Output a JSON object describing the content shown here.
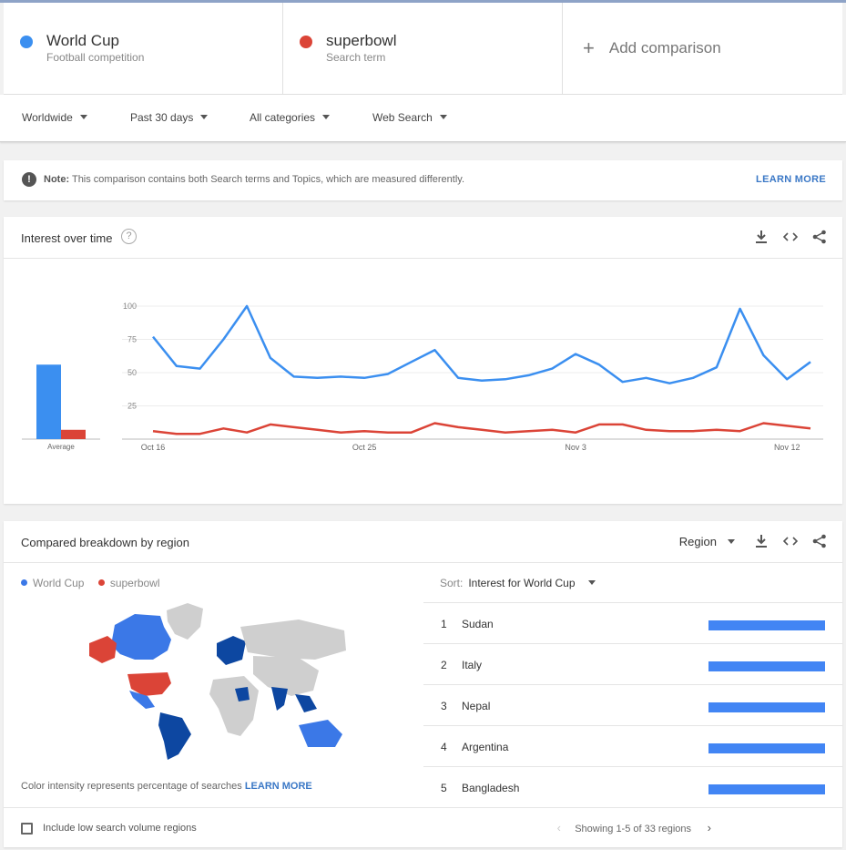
{
  "terms": [
    {
      "name": "World Cup",
      "type": "Football competition",
      "color": "#3b8ff0"
    },
    {
      "name": "superbowl",
      "type": "Search term",
      "color": "#db4437"
    }
  ],
  "add_comparison": "Add comparison",
  "filters": {
    "region": "Worldwide",
    "time": "Past 30 days",
    "category": "All categories",
    "property": "Web Search"
  },
  "note": {
    "label": "Note:",
    "text": "This comparison contains both Search terms and Topics, which are measured differently.",
    "link": "LEARN MORE"
  },
  "interest": {
    "title": "Interest over time",
    "average_label": "Average"
  },
  "chart_data": {
    "type": "line",
    "x": [
      "Oct 16",
      "Oct 17",
      "Oct 18",
      "Oct 19",
      "Oct 20",
      "Oct 21",
      "Oct 22",
      "Oct 23",
      "Oct 24",
      "Oct 25",
      "Oct 26",
      "Oct 27",
      "Oct 28",
      "Oct 29",
      "Oct 30",
      "Oct 31",
      "Nov 1",
      "Nov 2",
      "Nov 3",
      "Nov 4",
      "Nov 5",
      "Nov 6",
      "Nov 7",
      "Nov 8",
      "Nov 9",
      "Nov 10",
      "Nov 11",
      "Nov 12",
      "Nov 13"
    ],
    "x_tick_labels": [
      "Oct 16",
      "Oct 25",
      "Nov 3",
      "Nov 12"
    ],
    "y_ticks": [
      25,
      50,
      75,
      100
    ],
    "ylim": [
      0,
      100
    ],
    "series": [
      {
        "name": "World Cup",
        "color": "#3b8ff0",
        "values": [
          77,
          55,
          53,
          75,
          100,
          61,
          47,
          46,
          47,
          46,
          49,
          58,
          67,
          46,
          44,
          45,
          48,
          53,
          64,
          56,
          43,
          46,
          42,
          46,
          54,
          98,
          63,
          45,
          58
        ]
      },
      {
        "name": "superbowl",
        "color": "#db4437",
        "values": [
          6,
          4,
          4,
          8,
          5,
          11,
          9,
          7,
          5,
          6,
          5,
          5,
          12,
          9,
          7,
          5,
          6,
          7,
          5,
          11,
          11,
          7,
          6,
          6,
          7,
          6,
          12,
          10,
          8
        ]
      }
    ],
    "averages": [
      {
        "name": "World Cup",
        "value": 56
      },
      {
        "name": "superbowl",
        "value": 7
      }
    ]
  },
  "breakdown": {
    "title": "Compared breakdown by region",
    "region_select": "Region",
    "legend": [
      "World Cup",
      "superbowl"
    ],
    "color_note": "Color intensity represents percentage of searches",
    "color_note_link": "LEARN MORE",
    "sort_label": "Sort:",
    "sort_value": "Interest for World Cup",
    "rows": [
      {
        "rank": "1",
        "name": "Sudan",
        "share": 1.0
      },
      {
        "rank": "2",
        "name": "Italy",
        "share": 1.0
      },
      {
        "rank": "3",
        "name": "Nepal",
        "share": 1.0
      },
      {
        "rank": "4",
        "name": "Argentina",
        "share": 1.0
      },
      {
        "rank": "5",
        "name": "Bangladesh",
        "share": 1.0
      }
    ],
    "include_low": "Include low search volume regions",
    "showing": "Showing 1-5 of 33 regions"
  }
}
